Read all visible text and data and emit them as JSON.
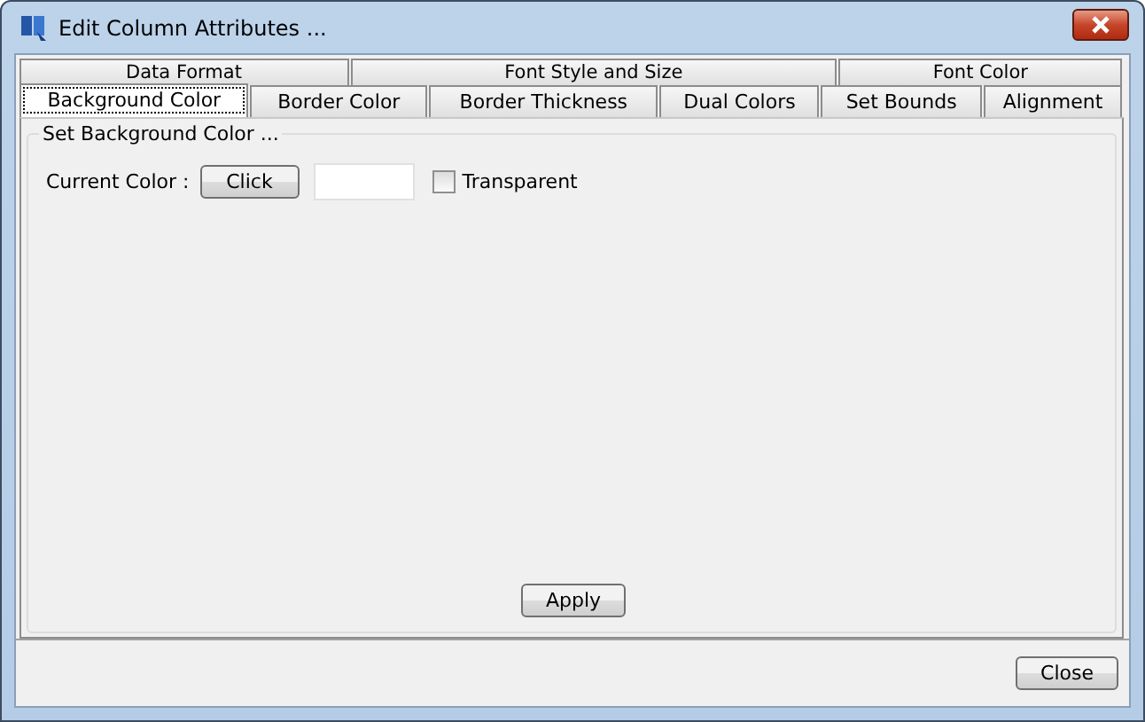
{
  "window": {
    "title": "Edit Column Attributes ..."
  },
  "tab_rows": [
    [
      {
        "label": "Data Format",
        "selected": false
      },
      {
        "label": "Font Style and Size",
        "selected": false
      },
      {
        "label": "Font Color",
        "selected": false
      }
    ],
    [
      {
        "label": "Background Color",
        "selected": true
      },
      {
        "label": "Border Color",
        "selected": false
      },
      {
        "label": "Border Thickness",
        "selected": false
      },
      {
        "label": "Dual Colors",
        "selected": false
      },
      {
        "label": "Set Bounds",
        "selected": false
      },
      {
        "label": "Alignment",
        "selected": false
      }
    ]
  ],
  "group": {
    "title": "Set Background Color ...",
    "color_label": "Current Color :",
    "color_button": "Click",
    "transparent": {
      "label": "Transparent",
      "checked": false
    }
  },
  "apply_button": "Apply",
  "close_button": "Close"
}
